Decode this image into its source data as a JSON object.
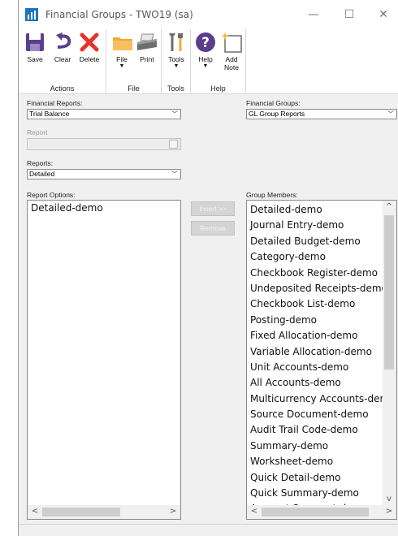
{
  "window": {
    "title": "Financial Groups  -  TWO19 (sa)"
  },
  "window_controls": {
    "minimize": "—",
    "maximize": "☐",
    "close": "✕"
  },
  "ribbon": {
    "actions": {
      "label": "Actions",
      "save": "Save",
      "clear": "Clear",
      "delete": "Delete"
    },
    "file": {
      "label": "File",
      "file": "File",
      "print": "Print"
    },
    "tools": {
      "label": "Tools",
      "tools": "Tools"
    },
    "help": {
      "label": "Help",
      "help": "Help",
      "add_note_line1": "Add",
      "add_note_line2": "Note"
    }
  },
  "form": {
    "financial_reports_label": "Financial Reports:",
    "financial_reports_value": "Trial Balance",
    "financial_groups_label": "Financial Groups:",
    "financial_groups_value": "GL Group Reports",
    "report_label": "Report",
    "reports_label": "Reports:",
    "reports_value": "Detailed",
    "report_options_label": "Report Options:",
    "group_members_label": "Group Members:",
    "insert_label": "Insert >>",
    "remove_label": "Remove"
  },
  "report_options": [
    "Detailed-demo"
  ],
  "group_members": [
    "Detailed-demo",
    "Journal Entry-demo",
    "Detailed Budget-demo",
    "Category-demo",
    "Checkbook Register-demo",
    "Undeposited Receipts-demo",
    "Checkbook List-demo",
    "Posting-demo",
    "Fixed Allocation-demo",
    "Variable Allocation-demo",
    "Unit Accounts-demo",
    "All Accounts-demo",
    "Multicurrency Accounts-demo",
    "Source Document-demo",
    "Audit Trail Code-demo",
    "Summary-demo",
    "Worksheet-demo",
    "Quick Detail-demo",
    "Quick Summary-demo",
    "Account Segment-demo"
  ],
  "colors": {
    "accent": "#1e73be",
    "delete_red": "#e8332a",
    "save_purple": "#5b3f8c",
    "folder_orange": "#f2a93b"
  },
  "icons": [
    "save-icon",
    "clear-icon",
    "delete-icon",
    "file-icon",
    "print-icon",
    "tools-icon",
    "help-icon",
    "add-note-icon"
  ]
}
